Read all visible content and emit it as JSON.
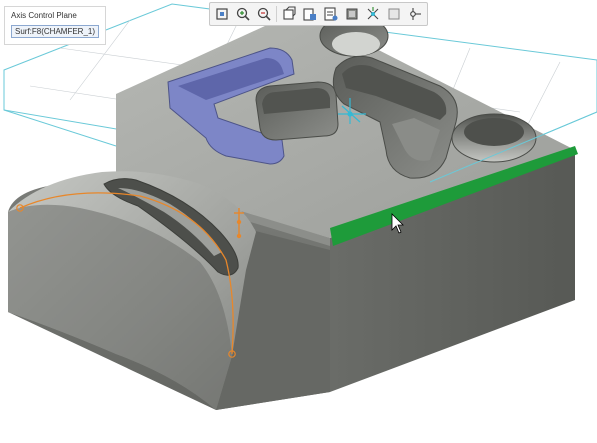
{
  "selection_panel": {
    "title": "Axis Control Plane",
    "field_value": "Surf:F8(CHAMFER_1)"
  },
  "toolbar": {
    "buttons": [
      {
        "icon": "refit-icon"
      },
      {
        "icon": "zoom-in-icon"
      },
      {
        "icon": "zoom-out-icon"
      },
      {
        "icon": "repaint-icon"
      },
      {
        "icon": "saved-orientations-icon"
      },
      {
        "icon": "view-manager-icon"
      },
      {
        "icon": "display-style-icon"
      },
      {
        "icon": "datum-display-filters-icon"
      },
      {
        "icon": "annotation-display-icon"
      },
      {
        "icon": "spin-center-icon"
      }
    ]
  },
  "colors": {
    "part_top": "#a8aaa6",
    "part_front": "#6f716d",
    "part_side": "#595b58",
    "selected_edge": "#1e9b3a",
    "highlight_cut": "#7d86c7",
    "datum_plane": "#6ac9d8",
    "sketch_curve": "#e8872a"
  }
}
